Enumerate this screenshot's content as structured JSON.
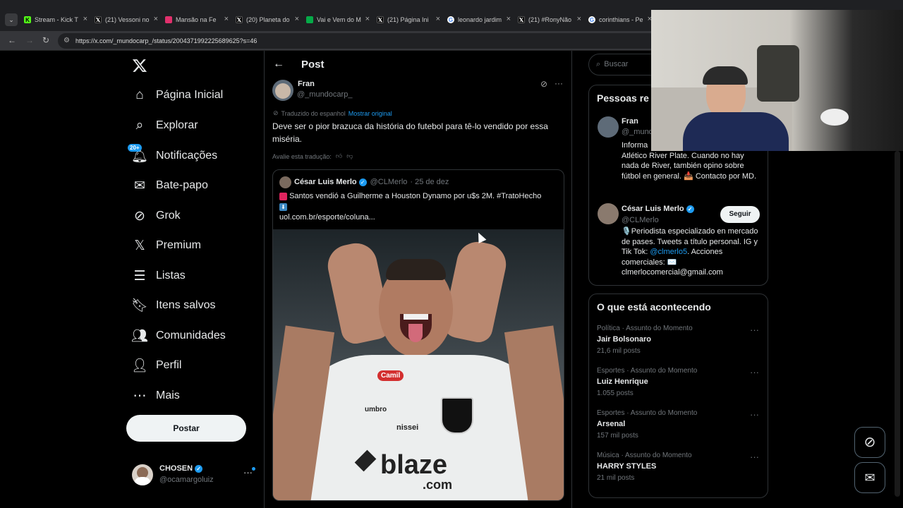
{
  "tabs": [
    {
      "title": "Stream - Kick T",
      "icon": "kick-icon",
      "color": "#53fc18"
    },
    {
      "title": "(21) Vessoni no",
      "icon": "x-logo-icon",
      "color": "#000000"
    },
    {
      "title": "Mansão na Fe",
      "icon": "instagram-icon",
      "color": "#e1306c"
    },
    {
      "title": "(20) Planeta do",
      "icon": "x-logo-icon",
      "color": "#000000"
    },
    {
      "title": "Vai e Vem do M",
      "icon": "ge-icon",
      "color": "#06aa48"
    },
    {
      "title": "(21) Página Ini",
      "icon": "x-logo-icon",
      "color": "#000000"
    },
    {
      "title": "leonardo jardim",
      "icon": "google-icon",
      "color": "#ffffff"
    },
    {
      "title": "(21) #RonyNão",
      "icon": "x-logo-icon",
      "color": "#000000"
    },
    {
      "title": "corinthians - Pe",
      "icon": "google-icon",
      "color": "#ffffff"
    }
  ],
  "address": {
    "url": "https://x.com/_mundocarp_/status/2004371992225689625?s=46"
  },
  "nav": {
    "items": [
      {
        "label": "Página Inicial",
        "icon": "home-icon"
      },
      {
        "label": "Explorar",
        "icon": "search-icon"
      },
      {
        "label": "Notificações",
        "icon": "bell-icon",
        "badge": "20+"
      },
      {
        "label": "Bate-papo",
        "icon": "mail-icon"
      },
      {
        "label": "Grok",
        "icon": "grok-icon"
      },
      {
        "label": "Premium",
        "icon": "x-logo-icon"
      },
      {
        "label": "Listas",
        "icon": "list-icon"
      },
      {
        "label": "Itens salvos",
        "icon": "bookmark-icon"
      },
      {
        "label": "Comunidades",
        "icon": "communities-icon"
      },
      {
        "label": "Perfil",
        "icon": "person-icon"
      },
      {
        "label": "Mais",
        "icon": "more-circle-icon"
      }
    ],
    "post_button": "Postar",
    "account": {
      "name": "CHOSEN",
      "handle": "@ocamargoluiz"
    }
  },
  "post": {
    "header": "Post",
    "author": {
      "name": "Fran",
      "handle": "@_mundocarp_"
    },
    "translated_label": "Traduzido do espanhol",
    "show_original": "Mostrar original",
    "text": "Deve ser o pior brazuca da história do futebol para tê-lo vendido por essa miséria.",
    "rate_translation": "Avalie esta tradução:",
    "quote": {
      "name": "César Luis Merlo",
      "handle": "@CLMerlo",
      "date": "· 25 de dez",
      "text": "Santos vendió a Guilherme a Houston Dynamo por u$s 2M. #TratoHecho",
      "link": "uol.com.br/esporte/coluna..."
    },
    "image_texts": {
      "sponsor": "blaze",
      "sponsor_domain": ".com",
      "shirt_brand": "umbro",
      "shirt_sponsor2": "nissei",
      "sleeve": "Camil"
    }
  },
  "sidebar": {
    "search_placeholder": "Buscar",
    "people_title": "Pessoas re",
    "people": [
      {
        "name": "Fran",
        "handle": "@_mund",
        "bio": "Informa\nAtlético River Plate. Cuando no hay nada de River, también opino sobre fútbol en general. 📥 Contacto por MD."
      },
      {
        "name": "César Luis Merlo",
        "handle": "@CLMerlo",
        "bio_pre": "🎙️Periodista especializado en mercado de pases. Tweets a título personal. IG y Tik Tok: ",
        "bio_link": "@clmerlo5",
        "bio_post": ". Acciones comerciales: ✉️ clmerlocomercial@gmail.com",
        "follow": "Seguir"
      }
    ],
    "trends_title": "O que está acontecendo",
    "trends": [
      {
        "context": "Política · Assunto do Momento",
        "name": "Jair Bolsonaro",
        "posts": "21,6 mil posts"
      },
      {
        "context": "Esportes · Assunto do Momento",
        "name": "Luiz Henrique",
        "posts": "1.055 posts"
      },
      {
        "context": "Esportes · Assunto do Momento",
        "name": "Arsenal",
        "posts": "157 mil posts"
      },
      {
        "context": "Música · Assunto do Momento",
        "name": "HARRY STYLES",
        "posts": "21 mil posts"
      }
    ]
  },
  "colors": {
    "accent": "#1d9bf0",
    "background": "#000000",
    "border": "#2f3336",
    "muted": "#71767b"
  }
}
